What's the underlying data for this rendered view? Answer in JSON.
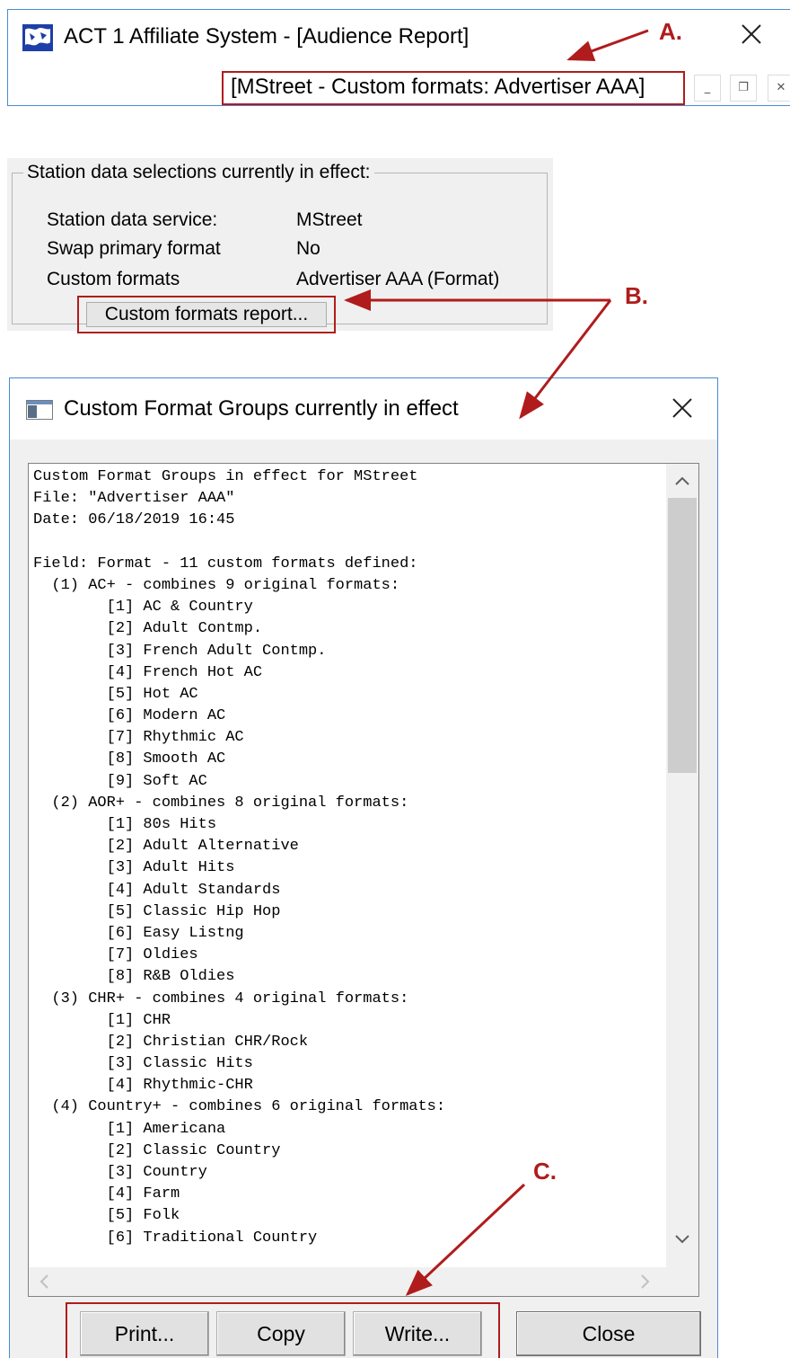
{
  "main_window": {
    "title": "ACT 1 Affiliate System - [Audience Report]",
    "mdi_title": "[MStreet - Custom formats: Advertiser AAA]",
    "controls": {
      "minimize": "_",
      "restore": "❐",
      "close": "✕"
    }
  },
  "station_data": {
    "legend": "Station data selections currently in effect:",
    "rows": [
      {
        "label": "Station data service:",
        "value": "MStreet"
      },
      {
        "label": "Swap primary format",
        "value": "No"
      },
      {
        "label": "Custom formats",
        "value": "Advertiser AAA (Format)"
      }
    ],
    "report_button": "Custom formats report..."
  },
  "dialog": {
    "title": "Custom Format Groups currently in effect",
    "report_lines": [
      "Custom Format Groups in effect for MStreet",
      "File: \"Advertiser AAA\"",
      "Date: 06/18/2019 16:45",
      "",
      "Field: Format - 11 custom formats defined:",
      "  (1) AC+ - combines 9 original formats:",
      "        [1] AC & Country",
      "        [2] Adult Contmp.",
      "        [3] French Adult Contmp.",
      "        [4] French Hot AC",
      "        [5] Hot AC",
      "        [6] Modern AC",
      "        [7] Rhythmic AC",
      "        [8] Smooth AC",
      "        [9] Soft AC",
      "  (2) AOR+ - combines 8 original formats:",
      "        [1] 80s Hits",
      "        [2] Adult Alternative",
      "        [3] Adult Hits",
      "        [4] Adult Standards",
      "        [5] Classic Hip Hop",
      "        [6] Easy Listng",
      "        [7] Oldies",
      "        [8] R&B Oldies",
      "  (3) CHR+ - combines 4 original formats:",
      "        [1] CHR",
      "        [2] Christian CHR/Rock",
      "        [3] Classic Hits",
      "        [4] Rhythmic-CHR",
      "  (4) Country+ - combines 6 original formats:",
      "        [1] Americana",
      "        [2] Classic Country",
      "        [3] Country",
      "        [4] Farm",
      "        [5] Folk",
      "        [6] Traditional Country"
    ],
    "buttons": {
      "print": "Print...",
      "copy": "Copy",
      "write": "Write...",
      "close": "Close"
    },
    "scroll": {
      "up": "up-arrow-icon",
      "down": "down-arrow-icon",
      "left": "left-arrow-icon",
      "right": "right-arrow-icon"
    }
  },
  "annotations": {
    "a": "A.",
    "b": "B.",
    "c": "C.",
    "color": "#b01c1c"
  }
}
